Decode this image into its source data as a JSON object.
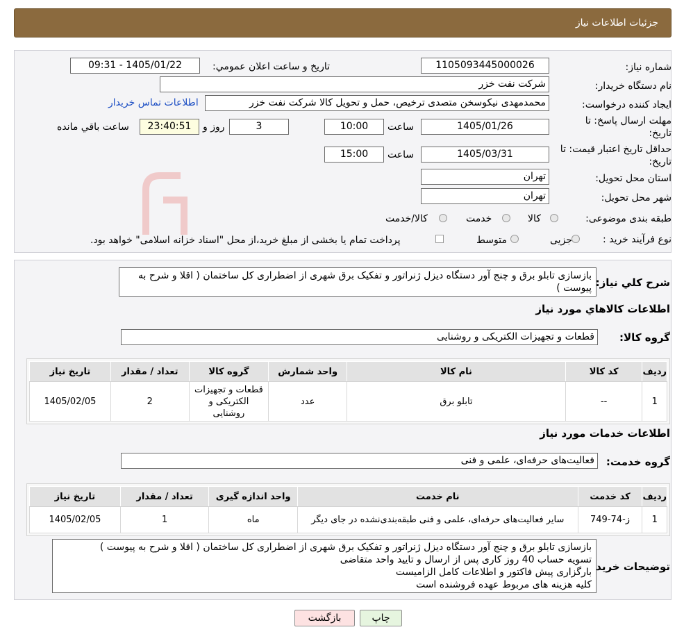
{
  "header": {
    "title": "جزئیات اطلاعات نیاز"
  },
  "details": {
    "need_number_label": "شماره نیاز:",
    "need_number": "1105093445000026",
    "announce_label": "تاریخ و ساعت اعلان عمومي:",
    "announce_value": "1405/01/22 - 09:31",
    "buyer_org_label": "نام دستگاه خریدار:",
    "buyer_org": "شرکت نفت خزر",
    "creator_label": "ایجاد کننده درخواست:",
    "creator": "محمدمهدی نیکوسخن متصدی ترخیص، حمل و تحویل کالا شرکت نفت خزر",
    "contact_link": "اطلاعات تماس خریدار",
    "deadline_label_1": "مهلت ارسال پاسخ: تا",
    "deadline_label_2": "تاریخ:",
    "deadline_date": "1405/01/26",
    "time_label": "ساعت",
    "deadline_time": "10:00",
    "days_value": "3",
    "days_label": "روز و",
    "remaining_time": "23:40:51",
    "remaining_label": "ساعت باقي مانده",
    "price_valid_label_1": "حداقل تاریخ اعتبار قیمت: تا",
    "price_valid_label_2": "تاریخ:",
    "price_valid_date": "1405/03/31",
    "price_valid_time": "15:00",
    "province_label": "استان محل تحویل:",
    "province": "تهران",
    "city_label": "شهر محل تحویل:",
    "city": "تهران",
    "category_label": "طبقه بندی موضوعی:",
    "category_options": [
      "کالا",
      "خدمت",
      "کالا/خدمت"
    ],
    "process_label": "نوع فرآیند خرید :",
    "process_options": [
      "جزیی",
      "متوسط"
    ],
    "payment_note": "پرداخت تمام یا بخشی از مبلغ خرید،از محل \"اسناد خزانه اسلامی\" خواهد بود."
  },
  "summary": {
    "label": "شرح کلي نیاز:",
    "text": "بازسازی تابلو برق و چنج آور دستگاه دیزل ژنراتور و تفکیک برق شهری از اضطراری کل ساختمان ( اقلا و شرح به پیوست )"
  },
  "goods": {
    "section_title": "اطلاعات کالاهاي مورد نياز",
    "group_label": "گروه کالا:",
    "group_value": "قطعات و تجهیزات الکتریکی و روشنایی",
    "headers": [
      "رديف",
      "کد کالا",
      "نام کالا",
      "واحد شمارش",
      "گروه کالا",
      "تعداد / مقدار",
      "تاریخ نیاز"
    ],
    "rows": [
      [
        "1",
        "--",
        "تابلو برق",
        "عدد",
        "قطعات و تجهیزات الکتریکی و روشنایی",
        "2",
        "1405/02/05"
      ]
    ]
  },
  "services": {
    "section_title": "اطلاعات خدمات مورد نیاز",
    "group_label": "گروه خدمت:",
    "group_value": "فعالیت‌های حرفه‌ای، علمی و فنی",
    "headers": [
      "رديف",
      "کد خدمت",
      "نام خدمت",
      "واحد اندازه گیری",
      "تعداد / مقدار",
      "تاریخ نیاز"
    ],
    "rows": [
      [
        "1",
        "ز-74-749",
        "سایر فعالیت‌های حرفه‌ای، علمی و فنی طبقه‌بندی‌نشده در جای دیگر",
        "ماه",
        "1",
        "1405/02/05"
      ]
    ]
  },
  "buyer_notes": {
    "label": "توضیحات خریدار:",
    "lines": [
      "بازسازی تابلو برق و چنج آور دستگاه دیزل ژنراتور و تفکیک برق شهری از اضطراری کل ساختمان ( اقلا و شرح به پیوست )",
      "تسویه حساب 40 روز کاری پس از ارسال و تایید واحد متقاضی",
      "بارگزاری پیش فاکتور و اطلاعات کامل الزامیست",
      "کلیه هزینه های مربوط عهده فروشنده است"
    ]
  },
  "actions": {
    "print": "چاپ",
    "back": "بازگشت"
  },
  "colors": {
    "header_bg": "#8b6a3e",
    "link": "#1d4fc4",
    "back_bg": "#fde2e2",
    "print_bg": "#e6f5df"
  }
}
